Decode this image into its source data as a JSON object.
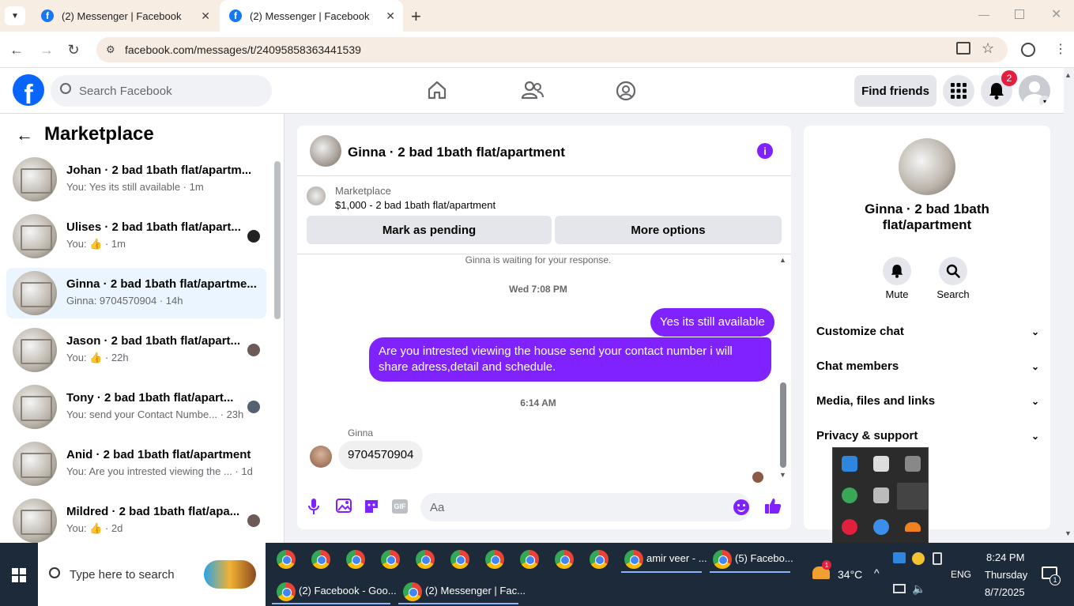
{
  "browser": {
    "tabs": [
      {
        "title": "(2) Messenger | Facebook"
      },
      {
        "title": "(2) Messenger | Facebook"
      }
    ],
    "url": "facebook.com/messages/t/24095858363441539"
  },
  "fb_header": {
    "search_placeholder": "Search Facebook",
    "find_friends": "Find friends",
    "notification_count": "2"
  },
  "left": {
    "title": "Marketplace",
    "conversations": [
      {
        "name": "Johan · 2 bad 1bath flat/apartm...",
        "preview": "You: Yes its still available · 1m"
      },
      {
        "name": "Ulises · 2 bad 1bath flat/apart...",
        "preview": "You: 👍 · 1m"
      },
      {
        "name": "Ginna · 2 bad 1bath flat/apartme...",
        "preview": "Ginna: 9704570904 · 14h"
      },
      {
        "name": "Jason · 2 bad 1bath flat/apart...",
        "preview": "You: 👍 · 22h"
      },
      {
        "name": "Tony · 2 bad 1bath flat/apart...",
        "preview": "You: send your Contact Numbe... · 23h"
      },
      {
        "name": "Anid · 2 bad 1bath flat/apartment",
        "preview": "You: Are you intrested viewing the ... · 1d"
      },
      {
        "name": "Mildred · 2 bad 1bath flat/apa...",
        "preview": "You: 👍 · 2d"
      }
    ]
  },
  "chat": {
    "title": "Ginna · 2 bad 1bath flat/apartment",
    "listing_source": "Marketplace",
    "listing_price_title": "$1,000 - 2 bad 1bath flat/apartment",
    "mark_pending": "Mark as pending",
    "more_options": "More options",
    "waiting_note": "Ginna is waiting for your response.",
    "timestamp1": "Wed 7:08 PM",
    "msg_out1": "Yes its still available",
    "msg_out2": "Are you intrested viewing the house send your contact number i will share adress,detail and schedule.",
    "timestamp2": "6:14 AM",
    "sender_name": "Ginna",
    "msg_in1": "9704570904",
    "composer_placeholder": "Aa"
  },
  "right": {
    "name": "Ginna · 2 bad 1bath flat/apartment",
    "mute": "Mute",
    "search": "Search",
    "sections": [
      "Customize chat",
      "Chat members",
      "Media, files and links",
      "Privacy & support"
    ]
  },
  "taskbar": {
    "search_placeholder": "Type here to search",
    "window1": "amir veer - ...",
    "window2": "(5) Facebo...",
    "window3": "(2) Facebook - Goo...",
    "window4": "(2) Messenger | Fac...",
    "weather_temp": "34°C",
    "weather_badge": "1",
    "lang": "ENG",
    "time": "8:24 PM",
    "day": "Thursday",
    "date": "8/7/2025",
    "notif_count": "1"
  },
  "colors": {
    "fb_blue": "#0866ff",
    "accent": "#7f22fe"
  }
}
